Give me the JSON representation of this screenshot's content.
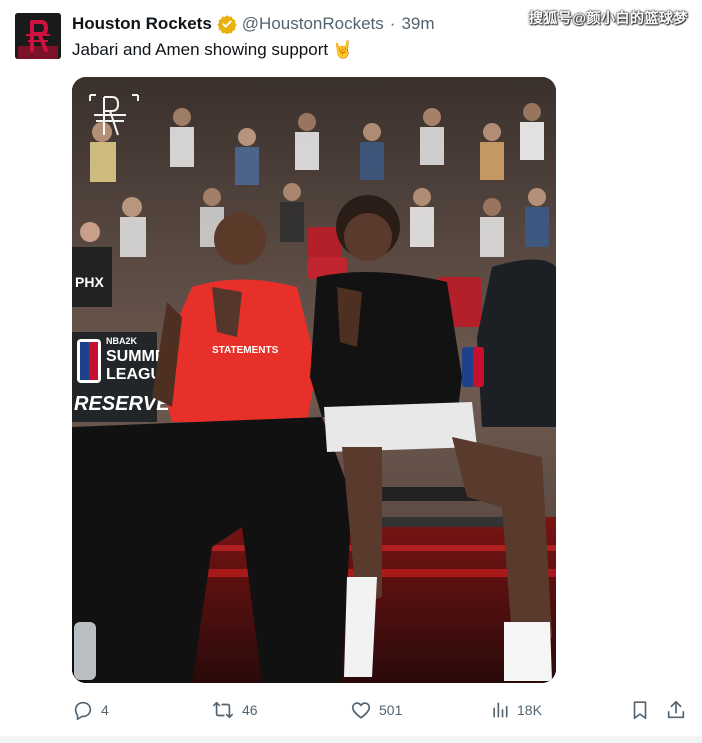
{
  "tweet": {
    "author_name": "Houston Rockets",
    "handle": "@HoustonRockets",
    "separator": "·",
    "time": "39m",
    "text": "Jabari and Amen showing support",
    "emoji": "🤘"
  },
  "watermark": "搜狐号@颜小白的篮球梦",
  "media_text": {
    "league_brand": "NBA2K",
    "league_line1": "SUMMER",
    "league_line2": "LEAGUE",
    "reserved": "RESERVED",
    "shirt_text": "STATEMENTS",
    "jersey_text": "PHX"
  },
  "actions": {
    "replies": "4",
    "reposts": "46",
    "likes": "501",
    "views": "18K"
  },
  "colors": {
    "rockets_red": "#ce1141",
    "verified_gold": "#e8b10e",
    "secondary_text": "#536471"
  }
}
